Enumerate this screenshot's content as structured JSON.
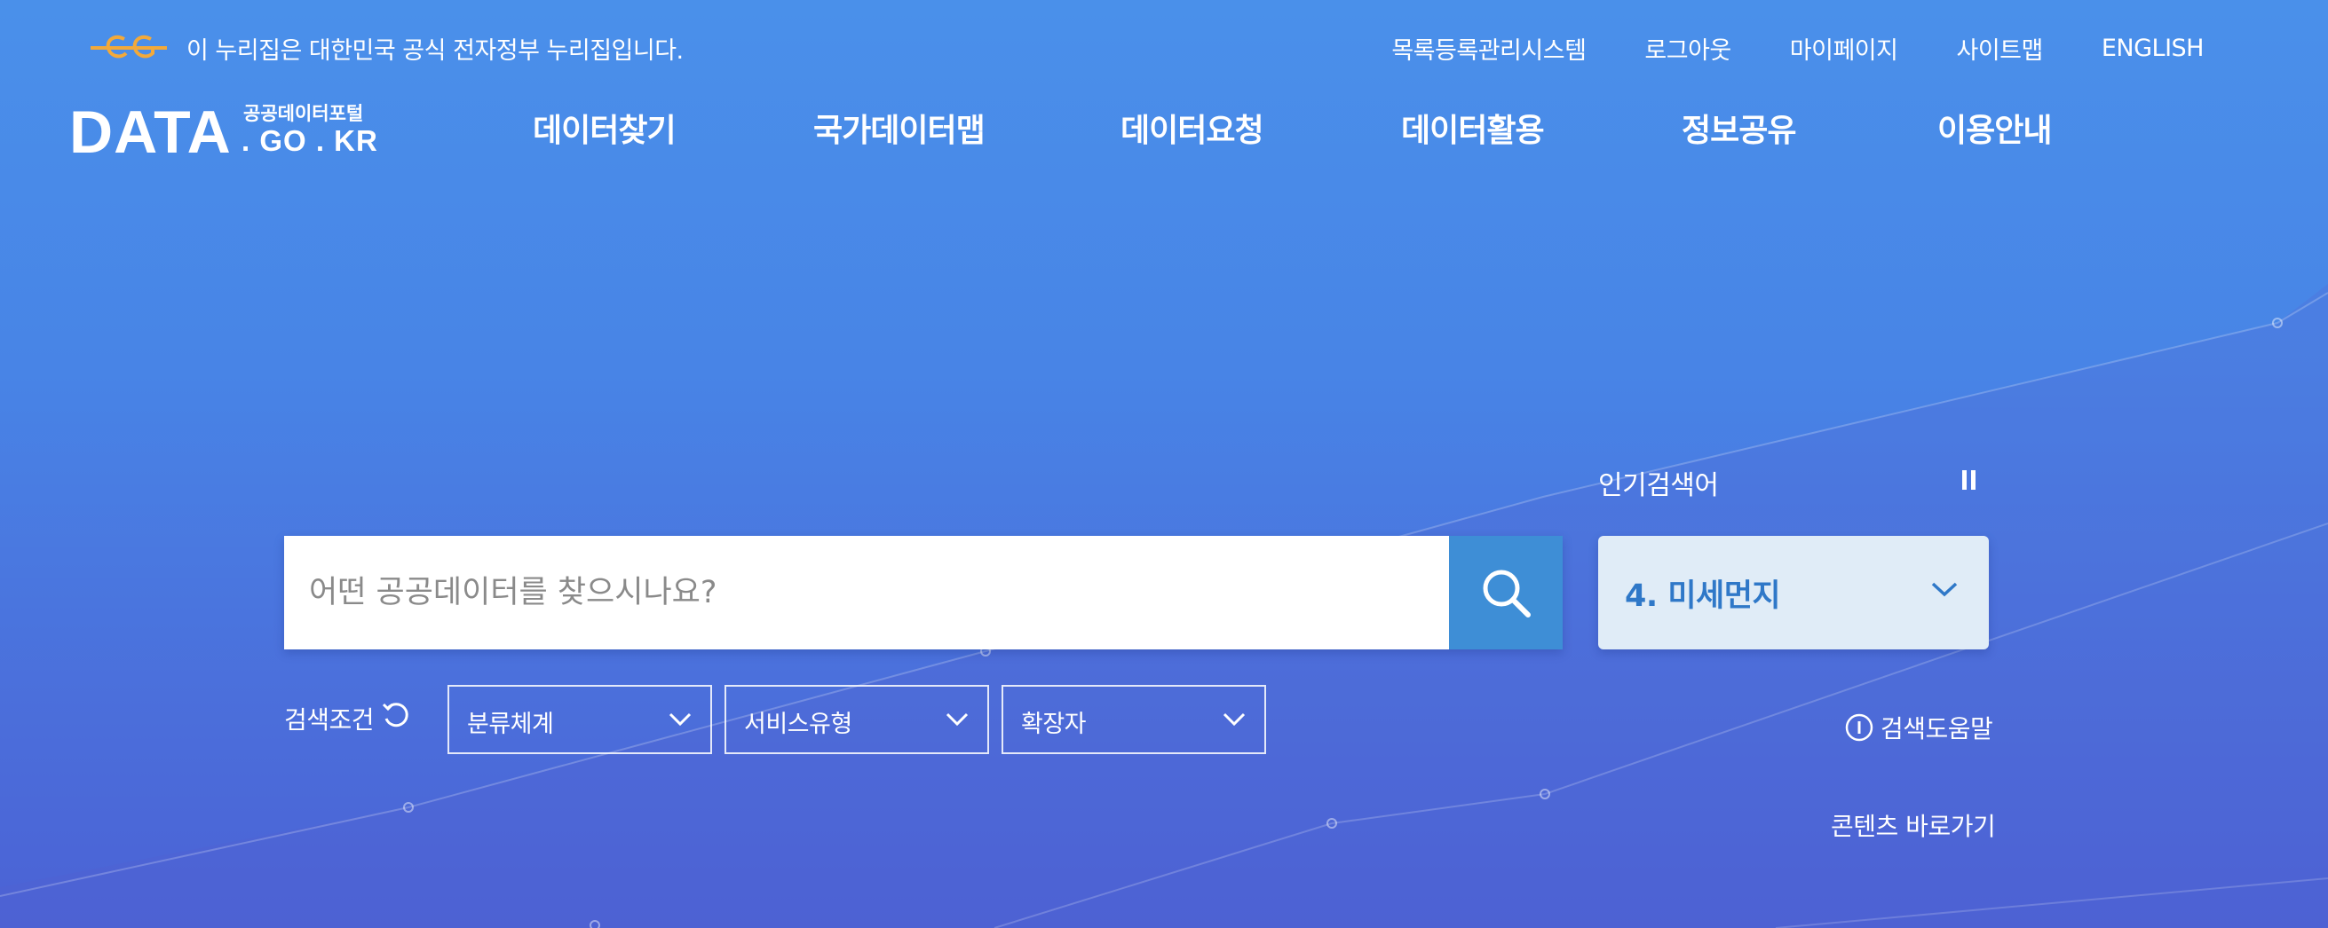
{
  "gov_notice": {
    "text": "이 누리집은 대한민국 공식 전자정부 누리집입니다.",
    "icon": "egov-logo-icon"
  },
  "util_nav": [
    "목록등록관리시스템",
    "로그아웃",
    "마이페이지",
    "사이트맵",
    "ENGLISH"
  ],
  "brand": {
    "main": "DATA",
    "sub": "공공데이터포털",
    "domain": ". GO . KR"
  },
  "gnb": [
    "데이터찾기",
    "국가데이터맵",
    "데이터요청",
    "데이터활용",
    "정보공유",
    "이용안내"
  ],
  "search": {
    "placeholder": "어떤 공공데이터를 찾으시나요?",
    "value": "",
    "button_icon": "search-icon"
  },
  "popular": {
    "label": "인기검색어",
    "current": "4. 미세먼지"
  },
  "conditions": {
    "label": "검색조건",
    "selects": [
      "분류체계",
      "서비스유형",
      "확장자"
    ]
  },
  "help_label": "검색도움말",
  "skip_label": "콘텐츠 바로가기",
  "colors": {
    "accent": "#3e8ed6",
    "popular_bg": "#e0ecf7",
    "popular_text": "#2f78c8",
    "gov_logo": "#f2a93b"
  }
}
